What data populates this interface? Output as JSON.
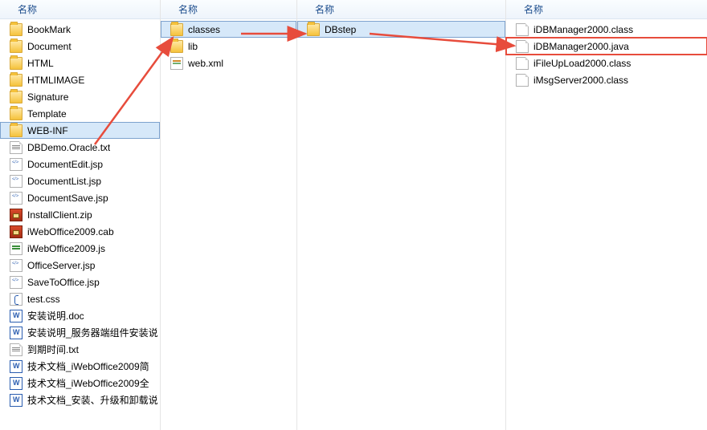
{
  "header_label": "名称",
  "panes": [
    {
      "items": [
        {
          "icon": "folder",
          "label": "BookMark"
        },
        {
          "icon": "folder",
          "label": "Document"
        },
        {
          "icon": "folder",
          "label": "HTML"
        },
        {
          "icon": "folder",
          "label": "HTMLIMAGE"
        },
        {
          "icon": "folder",
          "label": "Signature"
        },
        {
          "icon": "folder",
          "label": "Template"
        },
        {
          "icon": "folder-open",
          "label": "WEB-INF",
          "selected": true
        },
        {
          "icon": "txt",
          "label": "DBDemo.Oracle.txt"
        },
        {
          "icon": "code",
          "label": "DocumentEdit.jsp"
        },
        {
          "icon": "code",
          "label": "DocumentList.jsp"
        },
        {
          "icon": "code",
          "label": "DocumentSave.jsp"
        },
        {
          "icon": "zip",
          "label": "InstallClient.zip"
        },
        {
          "icon": "zip",
          "label": "iWebOffice2009.cab"
        },
        {
          "icon": "js",
          "label": "iWebOffice2009.js"
        },
        {
          "icon": "code",
          "label": "OfficeServer.jsp"
        },
        {
          "icon": "code",
          "label": "SaveToOffice.jsp"
        },
        {
          "icon": "css",
          "label": "test.css"
        },
        {
          "icon": "doc",
          "label": "安装说明.doc"
        },
        {
          "icon": "doc",
          "label": "安装说明_服务器端组件安装说"
        },
        {
          "icon": "txt",
          "label": "到期时间.txt"
        },
        {
          "icon": "doc",
          "label": "技术文档_iWebOffice2009简"
        },
        {
          "icon": "doc",
          "label": "技术文档_iWebOffice2009全"
        },
        {
          "icon": "doc",
          "label": "技术文档_安装、升级和卸载说"
        }
      ]
    },
    {
      "items": [
        {
          "icon": "folder-open",
          "label": "classes",
          "selected": true
        },
        {
          "icon": "folder",
          "label": "lib"
        },
        {
          "icon": "xml",
          "label": "web.xml"
        }
      ]
    },
    {
      "items": [
        {
          "icon": "folder-open",
          "label": "DBstep",
          "selected": true
        }
      ]
    },
    {
      "items": [
        {
          "icon": "file",
          "label": "iDBManager2000.class"
        },
        {
          "icon": "file",
          "label": "iDBManager2000.java",
          "highlighted": true
        },
        {
          "icon": "file",
          "label": "iFileUpLoad2000.class"
        },
        {
          "icon": "file",
          "label": "iMsgServer2000.class"
        }
      ]
    }
  ],
  "icon_class_map": {
    "folder": "i-folder",
    "folder-open": "i-folder-open",
    "file": "i-file",
    "txt": "i-txt",
    "zip": "i-zip",
    "code": "i-code",
    "js": "i-js",
    "css": "i-css",
    "doc": "i-doc",
    "xml": "i-xml"
  }
}
